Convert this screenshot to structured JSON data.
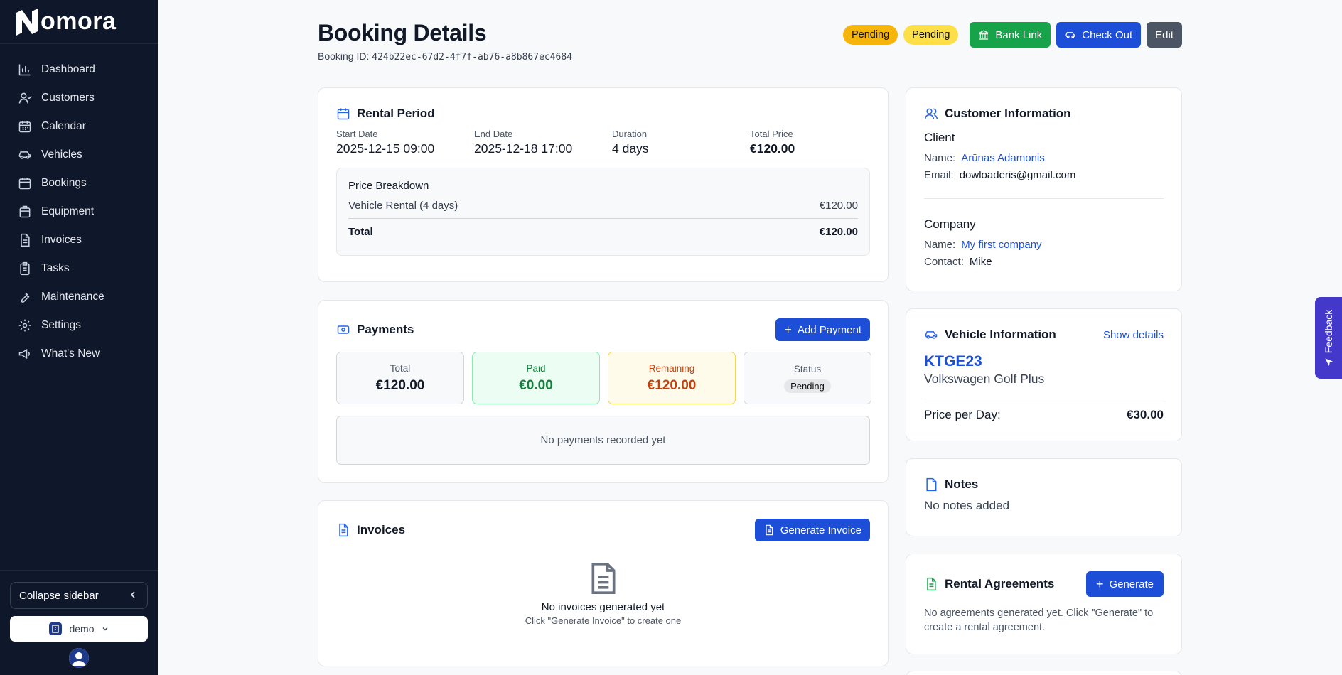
{
  "app": {
    "name": "omora"
  },
  "sidebar": {
    "items": [
      {
        "label": "Dashboard",
        "icon": "bar-chart-icon"
      },
      {
        "label": "Customers",
        "icon": "user-icon"
      },
      {
        "label": "Calendar",
        "icon": "calendar-icon"
      },
      {
        "label": "Vehicles",
        "icon": "car-icon"
      },
      {
        "label": "Bookings",
        "icon": "calendar-check-icon"
      },
      {
        "label": "Equipment",
        "icon": "box-icon"
      },
      {
        "label": "Invoices",
        "icon": "file-icon"
      },
      {
        "label": "Tasks",
        "icon": "clipboard-icon"
      },
      {
        "label": "Maintenance",
        "icon": "wrench-icon"
      },
      {
        "label": "Settings",
        "icon": "gear-icon"
      },
      {
        "label": "What's New",
        "icon": "megaphone-icon"
      }
    ],
    "collapse_label": "Collapse sidebar",
    "workspace": "demo"
  },
  "header": {
    "title": "Booking Details",
    "booking_id_label": "Booking ID:",
    "booking_id": "424b22ec-67d2-4f7f-ab76-a8b867ec4684",
    "badges": [
      "Pending",
      "Pending"
    ],
    "buttons": {
      "bank_link": "Bank Link",
      "check_out": "Check Out",
      "edit": "Edit"
    }
  },
  "rental_period": {
    "title": "Rental Period",
    "fields": [
      {
        "label": "Start Date",
        "value": "2025-12-15 09:00"
      },
      {
        "label": "End Date",
        "value": "2025-12-18 17:00"
      },
      {
        "label": "Duration",
        "value": "4 days"
      },
      {
        "label": "Total Price",
        "value": "€120.00"
      }
    ],
    "breakdown": {
      "title": "Price Breakdown",
      "rows": [
        {
          "label": "Vehicle Rental (4 days)",
          "value": "€120.00"
        },
        {
          "label": "Total",
          "value": "€120.00"
        }
      ]
    }
  },
  "payments": {
    "title": "Payments",
    "add_label": "Add Payment",
    "stats": {
      "total": {
        "label": "Total",
        "value": "€120.00"
      },
      "paid": {
        "label": "Paid",
        "value": "€0.00"
      },
      "remaining": {
        "label": "Remaining",
        "value": "€120.00"
      },
      "status": {
        "label": "Status",
        "value": "Pending"
      }
    },
    "empty": "No payments recorded yet"
  },
  "invoices": {
    "title": "Invoices",
    "generate_label": "Generate Invoice",
    "empty_title": "No invoices generated yet",
    "empty_hint": "Click \"Generate Invoice\" to create one"
  },
  "customer": {
    "title": "Customer Information",
    "client_label": "Client",
    "client_name_key": "Name:",
    "client_name": "Arūnas Adamonis",
    "client_email_key": "Email:",
    "client_email": "dowloaderis@gmail.com",
    "company_label": "Company",
    "company_name_key": "Name:",
    "company_name": "My first company",
    "company_contact_key": "Contact:",
    "company_contact": "Mike"
  },
  "vehicle": {
    "title": "Vehicle Information",
    "show_details": "Show details",
    "plate": "KTGE23",
    "model": "Volkswagen Golf Plus",
    "price_label": "Price per Day:",
    "price_value": "€30.00"
  },
  "notes": {
    "title": "Notes",
    "text": "No notes added"
  },
  "agreements": {
    "title": "Rental Agreements",
    "generate_label": "Generate",
    "text": "No agreements generated yet. Click \"Generate\" to create a rental agreement."
  },
  "feedback": {
    "label": "Feedback"
  },
  "colors": {
    "accent": "#1d4ed8",
    "sidebar_bg": "#0f172a",
    "success": "#16a34a",
    "warning": "#f5b50a"
  }
}
